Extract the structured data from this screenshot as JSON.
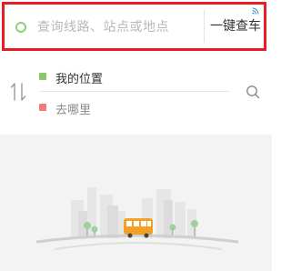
{
  "search": {
    "placeholder": "查询线路、站点或地点",
    "action_label": "一键查车",
    "ad_icon": "signal-ad-icon"
  },
  "route": {
    "from_label": "我的位置",
    "to_label": "去哪里"
  },
  "colors": {
    "highlight_border": "#ec1c24",
    "from_marker": "#8dc56a",
    "to_marker": "#f07c7c",
    "bus": "#f2a126"
  }
}
